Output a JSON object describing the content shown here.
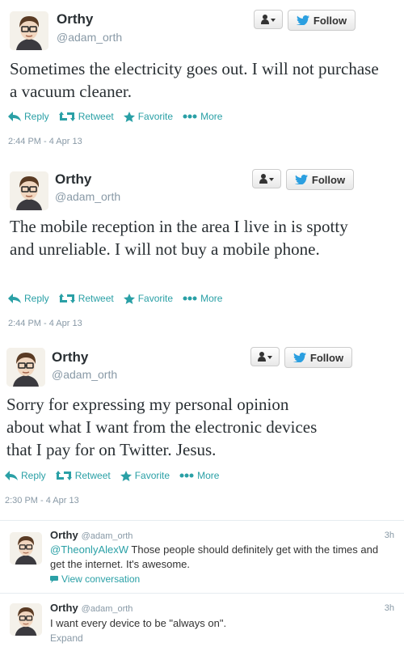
{
  "tweets": [
    {
      "name": "Orthy",
      "handle": "@adam_orth",
      "follow_label": "Follow",
      "text": "Sometimes the electricity goes out. I will not purchase a vacuum cleaner.",
      "time": "2:44 PM - 4 Apr 13"
    },
    {
      "name": "Orthy",
      "handle": "@adam_orth",
      "follow_label": "Follow",
      "text": "The mobile reception in the area I live in is spotty and unreliable. I will not buy a mobile phone.",
      "time": "2:44 PM - 4 Apr 13"
    },
    {
      "name": "Orthy",
      "handle": "@adam_orth",
      "follow_label": "Follow",
      "text": "Sorry for expressing my personal opinion about what I want from the electronic devices that I pay for on Twitter. Jesus.",
      "time": "2:30 PM - 4 Apr 13"
    }
  ],
  "actions": {
    "reply": "Reply",
    "retweet": "Retweet",
    "favorite": "Favorite",
    "more": "More"
  },
  "replies": [
    {
      "name": "Orthy",
      "handle": "@adam_orth",
      "time": "3h",
      "mention": "@TheonlyAlexW",
      "text": " Those people should definitely get with the times and get the internet. It's awesome.",
      "link": "View conversation"
    },
    {
      "name": "Orthy",
      "handle": "@adam_orth",
      "time": "3h",
      "text": "I want every device to be \"always on\".",
      "link": "Expand"
    }
  ],
  "colors": {
    "accent": "#2aa0a6",
    "muted": "#8899a6",
    "text": "#292f33"
  }
}
